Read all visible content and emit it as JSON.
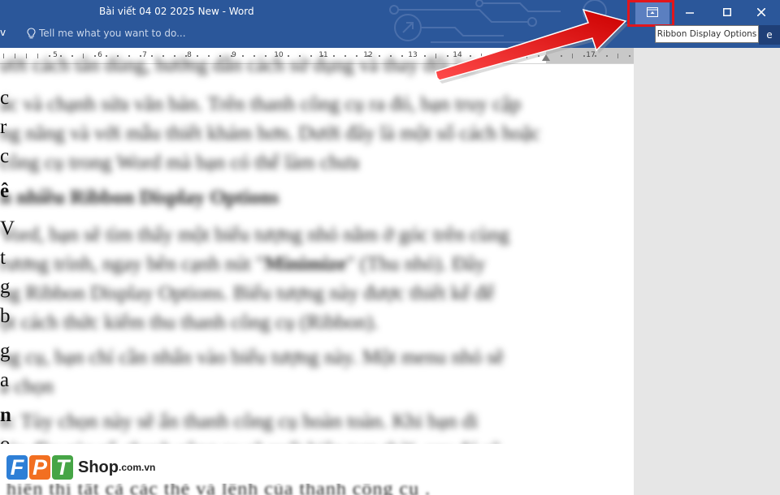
{
  "window": {
    "title": "Bài viết 04 02 2025 New - Word",
    "left_fragment": "v"
  },
  "ribbon": {
    "tell_me_placeholder": "Tell me what you want to do...",
    "share_fragment": "e"
  },
  "title_controls": {
    "ribbon_display_options_icon": "ribbon-display-options-icon",
    "minimize_icon": "minimize-icon",
    "maximize_icon": "maximize-icon",
    "close_icon": "close-icon"
  },
  "tooltip": {
    "text": "Ribbon Display Options"
  },
  "ruler": {
    "labels": [
      "5",
      "6",
      "7",
      "8",
      "9",
      "10",
      "11",
      "12",
      "13",
      "14",
      "17"
    ]
  },
  "document": {
    "left_chars": [
      "c",
      "r",
      "c",
      "ê",
      "V",
      "t",
      "g",
      "b",
      "g",
      "a",
      "n",
      "o"
    ],
    "bottom_line": "hiển thị tất cả các thẻ và lệnh của thanh công cụ ."
  },
  "logo": {
    "letters": [
      "F",
      "P",
      "T"
    ],
    "shop": "Shop",
    "domain": ".com.vn"
  },
  "colors": {
    "title_bar": "#2b579a",
    "highlight": "#e2161c",
    "logo_f": "#2e7fd6",
    "logo_p": "#f26f21",
    "logo_t": "#46a546"
  }
}
